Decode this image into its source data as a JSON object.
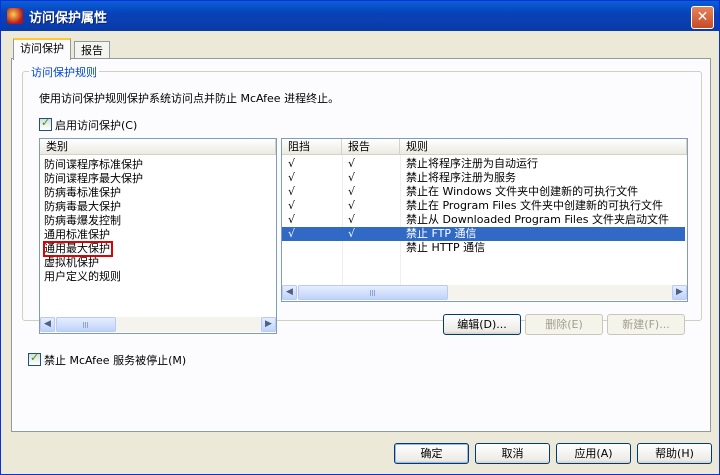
{
  "window": {
    "title": "访问保护属性",
    "close_glyph": "✕"
  },
  "tabs": [
    {
      "label": "访问保护"
    },
    {
      "label": "报告"
    }
  ],
  "group": {
    "label": "访问保护规则",
    "description": "使用访问保护规则保护系统访问点并防止 McAfee 进程终止。",
    "enable_label": "启用访问保护(C)",
    "enable_checked": true
  },
  "categories": {
    "header": "类别",
    "items": [
      "防间谍程序标准保护",
      "防间谍程序最大保护",
      "防病毒标准保护",
      "防病毒最大保护",
      "防病毒爆发控制",
      "通用标准保护",
      "通用最大保护",
      "虚拟机保护",
      "用户定义的规则"
    ],
    "highlighted_index": 6
  },
  "rules": {
    "headers": {
      "block": "阻挡",
      "report": "报告",
      "rule": "规则"
    },
    "rows": [
      {
        "block": "√",
        "report": "√",
        "rule": "禁止将程序注册为自动运行"
      },
      {
        "block": "√",
        "report": "√",
        "rule": "禁止将程序注册为服务"
      },
      {
        "block": "√",
        "report": "√",
        "rule": "禁止在 Windows 文件夹中创建新的可执行文件"
      },
      {
        "block": "√",
        "report": "√",
        "rule": "禁止在 Program Files 文件夹中创建新的可执行文件"
      },
      {
        "block": "√",
        "report": "√",
        "rule": "禁止从 Downloaded Program Files 文件夹启动文件"
      },
      {
        "block": "√",
        "report": "√",
        "rule": "禁止 FTP 通信"
      },
      {
        "block": "",
        "report": "",
        "rule": "禁止 HTTP 通信"
      }
    ],
    "selected_index": 5
  },
  "rule_buttons": {
    "edit": "编辑(D)...",
    "delete": "删除(E)",
    "new": "新建(F)..."
  },
  "prevent_stop": {
    "label": "禁止 McAfee 服务被停止(M)",
    "checked": true
  },
  "footer": {
    "ok": "确定",
    "cancel": "取消",
    "apply": "应用(A)",
    "help": "帮助(H)"
  },
  "colors": {
    "title_bar": "#0A4BC6",
    "selection": "#316AC5",
    "highlight_box": "#E00000",
    "group_label": "#0046D5"
  }
}
